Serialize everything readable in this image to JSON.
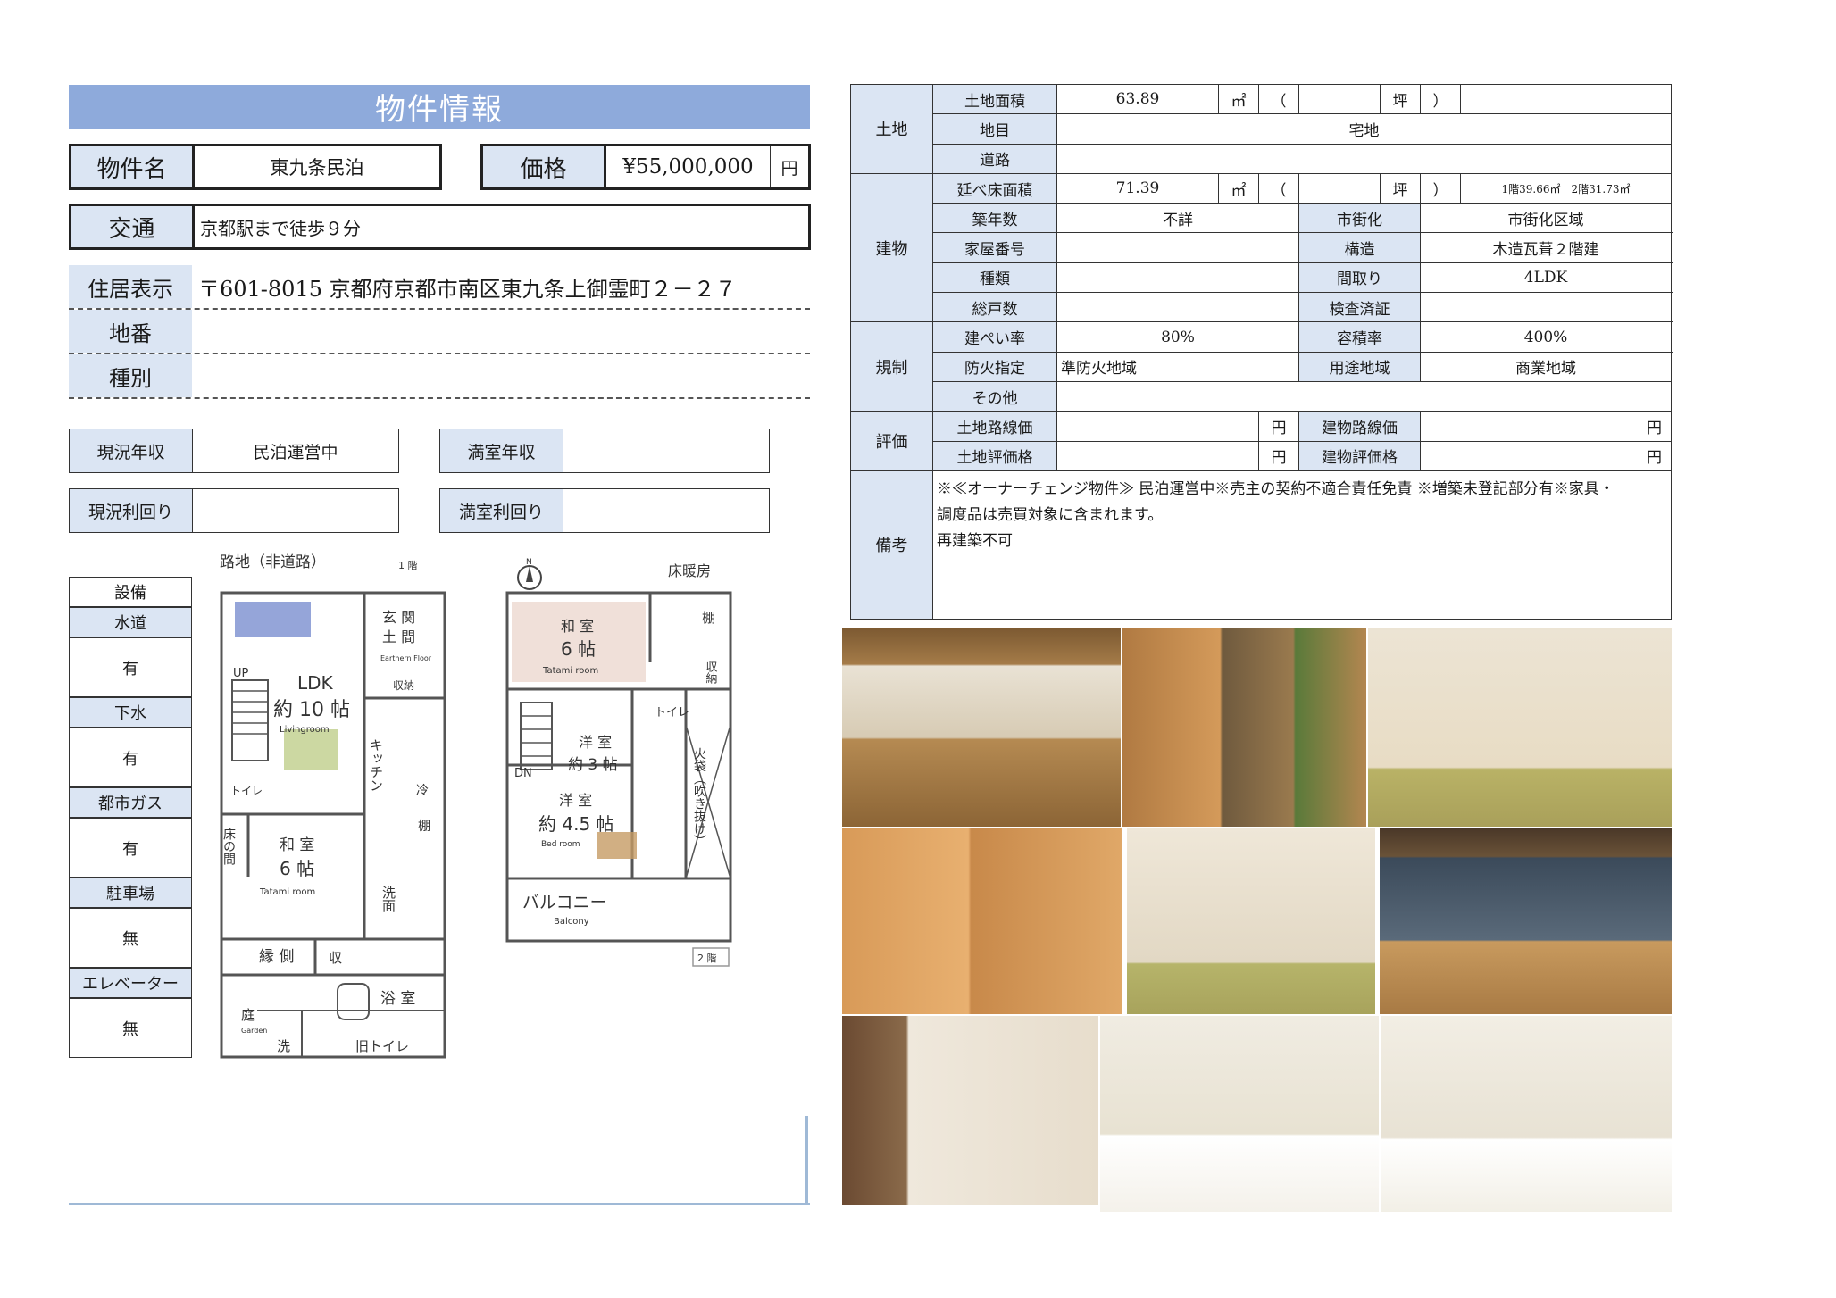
{
  "header": {
    "title": "物件情報"
  },
  "property": {
    "name_label": "物件名",
    "name": "東九条民泊",
    "price_label": "価格",
    "price": "¥55,000,000",
    "price_unit": "円",
    "access_label": "交通",
    "access": "京都駅まで徒歩９分",
    "address_label": "住居表示",
    "address": "〒601-8015 京都府京都市南区東九条上御霊町２－２７",
    "lot_label": "地番",
    "lot": "",
    "type_label": "種別",
    "type": ""
  },
  "income": {
    "current_label": "現況年収",
    "current": "民泊運営中",
    "full_label": "満室年収",
    "full": "",
    "current_yield_label": "現況利回り",
    "current_yield": "",
    "full_yield_label": "満室利回り",
    "full_yield": ""
  },
  "amenities": {
    "header": "設備",
    "items": [
      {
        "label": "水道",
        "value": "有"
      },
      {
        "label": "下水",
        "value": "有"
      },
      {
        "label": "都市ガス",
        "value": "有"
      },
      {
        "label": "駐車場",
        "value": "無"
      },
      {
        "label": "エレベーター",
        "value": "無"
      }
    ]
  },
  "floorplan": {
    "road": "路地（非道路）",
    "floor1": "1 階",
    "floor2": "2 階",
    "north": "N",
    "floor_heating": "床暖房",
    "genkan": "玄 関",
    "doma": "土 間",
    "earthen": "Earthern Floor",
    "storage1": "収納",
    "up": "UP",
    "ldk": "LDK",
    "ldk_size": "約 10 帖",
    "living": "Livingroom",
    "kitchen": "キッチン",
    "fridge": "冷",
    "toilet1": "トイレ",
    "tokonoma": "床の間",
    "washitsu": "和 室",
    "six_jo": "6 帖",
    "tatami": "Tatami room",
    "shelf": "棚",
    "senmen": "洗面",
    "engawa": "縁 側",
    "storage2": "収",
    "garden": "庭",
    "garden_en": "Garden",
    "bath": "浴 室",
    "wash": "洗",
    "old_toilet": "旧トイレ",
    "washitsu2": "和 室",
    "six_jo2": "6 帖",
    "tatami2": "Tatami room",
    "shelf2": "棚",
    "storage3": "収納",
    "toilet2": "トイレ",
    "yoshitsu1": "洋 室",
    "three_jo": "約 3 帖",
    "dn": "DN",
    "yoshitsu2": "洋 室",
    "four5_jo": "約 4.5 帖",
    "bedroom": "Bed room",
    "fukinuke": "火袋（吹き抜け）",
    "balcony": "バルコニー",
    "balcony_en": "Balcony"
  },
  "spec": {
    "land": {
      "cat": "土地",
      "area_label": "土地面積",
      "area": "63.89",
      "sqm": "㎡",
      "paren_open": "（",
      "tsubo": "坪",
      "paren_close": "）",
      "chimoku_label": "地目",
      "chimoku": "宅地",
      "road_label": "道路",
      "road": ""
    },
    "building": {
      "cat": "建物",
      "floor_area_label": "延べ床面積",
      "floor_area": "71.39",
      "floor_breakdown": "1階39.66㎡　2階31.73㎡",
      "age_label": "築年数",
      "age": "不詳",
      "urban_label": "市街化",
      "urban": "市街化区域",
      "house_no_label": "家屋番号",
      "house_no": "",
      "structure_label": "構造",
      "structure": "木造瓦葺２階建",
      "kind_label": "種類",
      "kind": "",
      "layout_label": "間取り",
      "layout": "4LDK",
      "units_label": "総戸数",
      "units": "",
      "inspection_label": "検査済証",
      "inspection": ""
    },
    "regulation": {
      "cat": "規制",
      "bcr_label": "建ぺい率",
      "bcr": "80%",
      "far_label": "容積率",
      "far": "400%",
      "fire_label": "防火指定",
      "fire": "準防火地域",
      "zoning_label": "用途地域",
      "zoning": "商業地域",
      "other_label": "その他",
      "other": ""
    },
    "valuation": {
      "cat": "評価",
      "land_route_label": "土地路線価",
      "land_route": "",
      "yen": "円",
      "bldg_route_label": "建物路線価",
      "bldg_route": "",
      "land_eval_label": "土地評価格",
      "land_eval": "",
      "bldg_eval_label": "建物評価格",
      "bldg_eval": ""
    },
    "remarks": {
      "cat": "備考",
      "line1": "※≪オーナーチェンジ物件≫ 民泊運営中※売主の契約不適合責任免責 ※増築未登記部分有※家具・",
      "line2": "調度品は売買対象に含まれます。",
      "line3": "再建築不可"
    }
  }
}
